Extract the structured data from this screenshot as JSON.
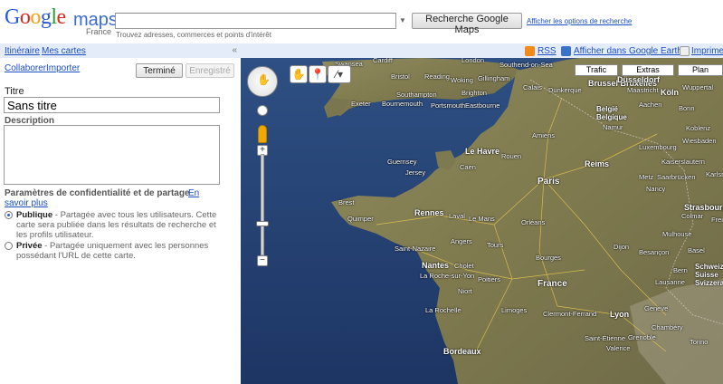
{
  "header": {
    "logo_google": "Google",
    "logo_maps": "maps",
    "logo_country": "France",
    "search": {
      "value": "",
      "placeholder": ""
    },
    "search_hint": "Trouvez adresses, commerces et points d'intérêt",
    "search_button": "Recherche Google Maps",
    "advanced_link": "Afficher les options de recherche"
  },
  "left_panel": {
    "nav": {
      "itinerary": "Itinéraire",
      "my_maps": "Mes cartes",
      "collapse": "«"
    },
    "links": {
      "collaborate": "Collaborer",
      "import": "Importer"
    },
    "buttons": {
      "done": "Terminé",
      "save": "Enregistré"
    },
    "title_label": "Titre",
    "title_value": "Sans titre",
    "description_label": "Description",
    "privacy": {
      "heading": "Paramètres de confidentialité et de partage",
      "more_1": "En",
      "more_2": "savoir plus",
      "public_label": "Publique",
      "public_text": " - Partagée avec tous les utilisateurs. Cette carte sera publiée dans les résultats de recherche et les profils utilisateur.",
      "private_label": "Privée",
      "private_text": " - Partagée uniquement avec les personnes possédant l'URL de cette carte.",
      "selected": "public"
    }
  },
  "map": {
    "toolbar": {
      "rss": "RSS",
      "earth": "Afficher dans Google Earth",
      "print": "Imprimer"
    },
    "types": {
      "traffic": "Trafic",
      "more": "Extras",
      "plan": "Plan"
    },
    "tools": {
      "hand": "✋",
      "pin": "📍",
      "line": "⁄▾"
    },
    "zoom": {
      "plus": "+",
      "minus": "−",
      "level_fraction": 0.62
    },
    "labels": [
      "Swansea",
      "Cardiff",
      "London",
      "Southend-on-Sea",
      "Bristol",
      "Reading",
      "Woking",
      "Gillingham",
      "Calais",
      "Dunkerque",
      "Brussel Bruxelles",
      "Düsseldorf",
      "Köln",
      "Wuppertal",
      "Southampton",
      "Brighton",
      "Exeter",
      "Bournemouth",
      "Portsmouth",
      "Eastbourne",
      "België Belgique",
      "Aachen",
      "Bonn",
      "Maastricht",
      "Namur",
      "Le Havre",
      "Rouen",
      "Amiens",
      "Reims",
      "Luxembourg",
      "Koblenz",
      "Wiesbaden",
      "Guernsey",
      "Jersey",
      "Caen",
      "Kaiserslautern",
      "Paris",
      "Metz",
      "Saarbrücken",
      "Karlsr",
      "Nancy",
      "Brest",
      "Quimper",
      "Rennes",
      "Laval",
      "Le Mans",
      "Orléans",
      "Strasbourg",
      "Colmar",
      "Frei",
      "Mulhouse",
      "Saint-Nazaire",
      "Angers",
      "Tours",
      "Dijon",
      "Besançon",
      "Basel",
      "Nantes",
      "Cholet",
      "La Roche-sur-Yon",
      "Poitiers",
      "Bourges",
      "Bern",
      "Schweiz Suisse Svizzera",
      "Niort",
      "France",
      "Lausanne",
      "La Rochelle",
      "Limoges",
      "Clermont-Ferrand",
      "Lyon",
      "Genève",
      "Chambéry",
      "Saint-Étienne",
      "Grenoble",
      "Torino",
      "Valence",
      "Bordeaux"
    ]
  },
  "colors": {
    "link": "#1c4fc4",
    "toolbar_bg": "#e5ecf9",
    "ocean": "#27467a",
    "land": "#8c8a5a"
  }
}
